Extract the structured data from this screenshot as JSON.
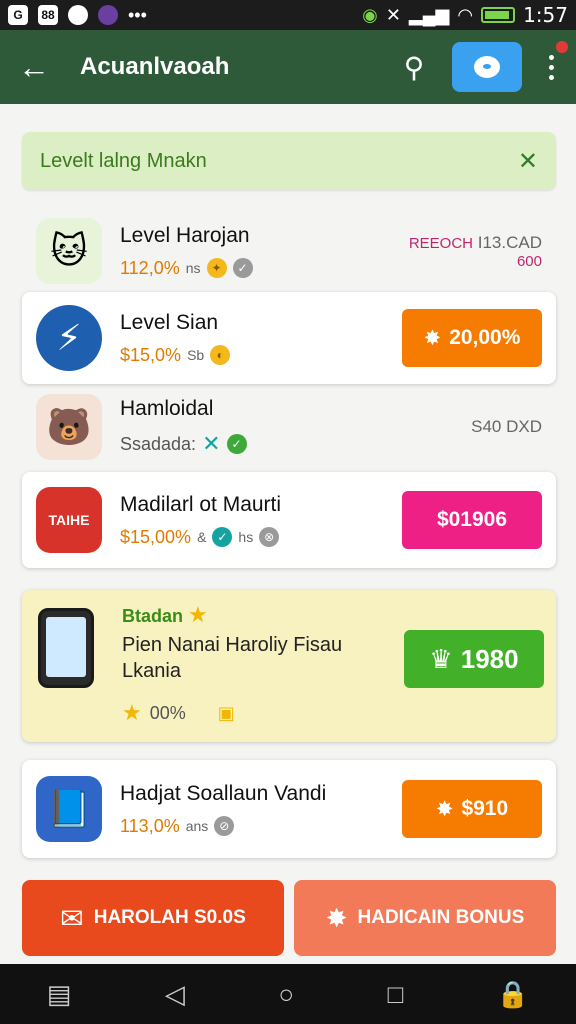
{
  "status_bar": {
    "icons": [
      "G",
      "88",
      "",
      ""
    ],
    "more": "•••",
    "time": "1:57"
  },
  "app_bar": {
    "title": "Acuanlvaoah"
  },
  "banner": {
    "text": "Levelt lalng Mnakn",
    "close": "✕"
  },
  "rows": [
    {
      "name": "Level Harojan",
      "percent": "112,0%",
      "extra": "ns",
      "side_top": "REEOCH",
      "side_bottom": "600",
      "side_value": "I13.CAD"
    },
    {
      "name": "Level Sian",
      "percent": "$15,0%",
      "extra": "Sb",
      "action": "20,00%"
    },
    {
      "name": "Hamloidal",
      "percent": "Ssadada:",
      "side_value": "S40 DXD"
    },
    {
      "name": "Madilarl ot Maurti",
      "percent": "$15,00%",
      "extra": "&",
      "extra2": "hs",
      "badge": "TAIHE",
      "action": "$01906"
    },
    {
      "name": "Hadjat Soallaun Vandi",
      "percent": "113,0%",
      "extra": "ans",
      "action": "$910"
    }
  ],
  "featured": {
    "tag": "Btadan",
    "line1": "Pien Nanai Haroliy Fisau",
    "line2": "Lkania",
    "foot": "00%",
    "action": "1980"
  },
  "bottom": {
    "left": "HAROLAH S0.0S",
    "right": "HADICAIN BONUS"
  },
  "colors": {
    "appbar": "#2e5a3a",
    "orange": "#f57c00",
    "pink": "#ee1f85",
    "green": "#43b02a"
  }
}
